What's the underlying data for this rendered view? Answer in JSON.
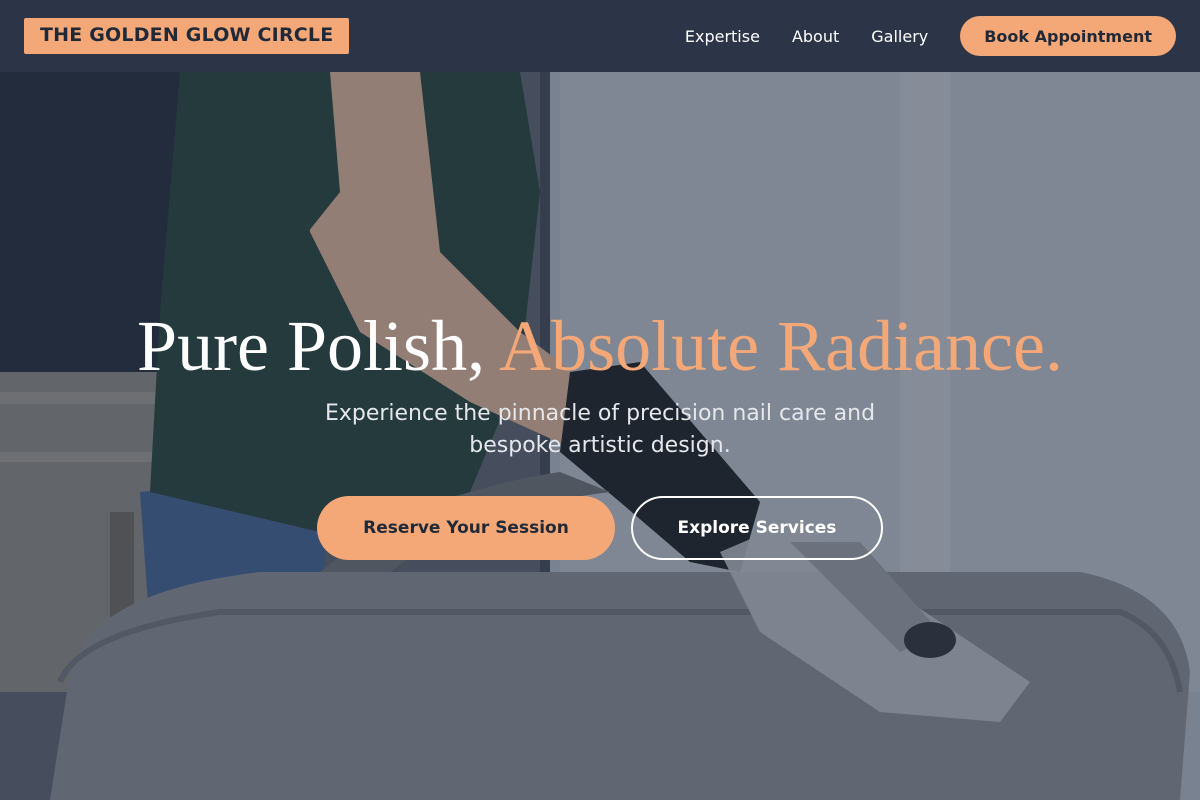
{
  "brand": {
    "logo_text": "THE GOLDEN GLOW CIRCLE"
  },
  "nav": {
    "links": [
      {
        "label": "Expertise"
      },
      {
        "label": "About"
      },
      {
        "label": "Gallery"
      }
    ],
    "cta_label": "Book Appointment"
  },
  "hero": {
    "title_plain": "Pure Polish,",
    "title_accent": "Absolute Radiance.",
    "subtitle": "Experience the pinnacle of precision nail care and bespoke artistic design.",
    "primary_cta": "Reserve Your Session",
    "secondary_cta": "Explore Services",
    "image": "person in green shirt and black gloves cleaning a grey upholstered ottoman with an extraction tool"
  },
  "colors": {
    "nav_bg": "#2b3547",
    "accent": "#f4a877",
    "dark_text": "#1f2937",
    "overlay": "#2d3748"
  }
}
